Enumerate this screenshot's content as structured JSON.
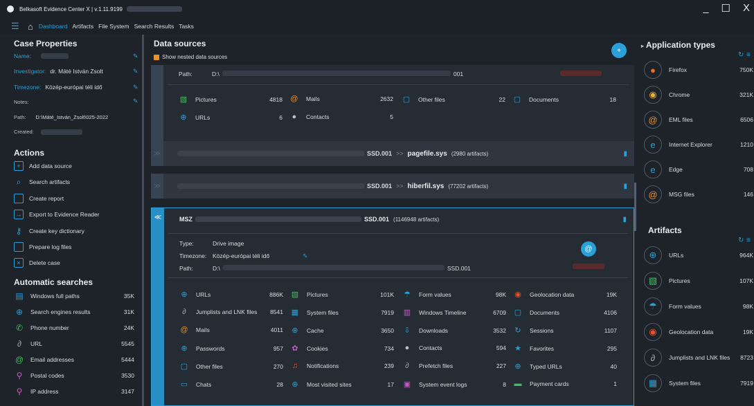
{
  "window": {
    "title": "Belkasoft Evidence Center X | v.1.11.9199",
    "minimize": "_",
    "maximize": "☐",
    "close": "X"
  },
  "menu": {
    "tabs": [
      "Dashboard",
      "Artifacts",
      "File System",
      "Search Results",
      "Tasks"
    ]
  },
  "case_properties": {
    "title": "Case Properties",
    "name_label": "Name:",
    "investigator_label": "Investigator:",
    "investigator": "dr. Máté István Zsolt",
    "timezone_label": "Timezone:",
    "timezone": "Közép-európai téli idő",
    "notes_label": "Notes:",
    "path_label": "Path:",
    "path": "D:\\Máté_István_Zsolt\\025-2022",
    "created_label": "Created:"
  },
  "actions": {
    "title": "Actions",
    "items": [
      "Add data source",
      "Search artifacts",
      "Create report",
      "Export to Evidence Reader",
      "Create key dictionary",
      "Prepare log files",
      "Delete case"
    ]
  },
  "auto_searches": {
    "title": "Automatic searches",
    "items": [
      {
        "label": "Windows full paths",
        "count": "35K"
      },
      {
        "label": "Search engines results",
        "count": "31K"
      },
      {
        "label": "Phone number",
        "count": "24K"
      },
      {
        "label": "URL",
        "count": "5545"
      },
      {
        "label": "Email addresses",
        "count": "5444"
      },
      {
        "label": "Postal codes",
        "count": "3530"
      },
      {
        "label": "IP address",
        "count": "3147"
      }
    ]
  },
  "data_sources": {
    "title": "Data sources",
    "nested_label": "Show nested data sources",
    "card1": {
      "path_label": "Path:",
      "path_prefix": "D:\\",
      "path_suffix": "001",
      "artifacts": [
        {
          "icon": "pictures-icon",
          "label": "Pictures",
          "count": "4818"
        },
        {
          "icon": "mails-icon",
          "label": "Mails",
          "count": "2632"
        },
        {
          "icon": "other-files-icon",
          "label": "Other files",
          "count": "22"
        },
        {
          "icon": "documents-icon",
          "label": "Documents",
          "count": "18"
        },
        {
          "icon": "urls-icon",
          "label": "URLs",
          "count": "6"
        },
        {
          "icon": "contacts-icon",
          "label": "Contacts",
          "count": "5"
        }
      ]
    },
    "collapsed": [
      {
        "ssd": "SSD.001",
        "arrow": ">>",
        "file": "pagefile.sys",
        "info": "(2980 artifacts)"
      },
      {
        "ssd": "SSD.001",
        "arrow": ">>",
        "file": "hiberfil.sys",
        "info": "(77202 artifacts)"
      }
    ],
    "card2": {
      "name_prefix": "MSZ",
      "ssd": "SSD.001",
      "info": "(1146948 artifacts)",
      "type_label": "Type:",
      "type": "Drive image",
      "timezone_label": "Timezone:",
      "timezone": "Közép-európai téli idő",
      "path_label": "Path:",
      "path_prefix": "D:\\",
      "path_suffix": "SSD.001",
      "artifacts": [
        {
          "label": "URLs",
          "count": "886K"
        },
        {
          "label": "Pictures",
          "count": "101K"
        },
        {
          "label": "Form values",
          "count": "98K"
        },
        {
          "label": "Geolocation data",
          "count": "19K"
        },
        {
          "label": "Jumplists and LNK files",
          "count": "8541"
        },
        {
          "label": "System files",
          "count": "7919"
        },
        {
          "label": "Windows Timeline",
          "count": "6709"
        },
        {
          "label": "Documents",
          "count": "4106"
        },
        {
          "label": "Mails",
          "count": "4011"
        },
        {
          "label": "Cache",
          "count": "3650"
        },
        {
          "label": "Downloads",
          "count": "3532"
        },
        {
          "label": "Sessions",
          "count": "1107"
        },
        {
          "label": "Passwords",
          "count": "957"
        },
        {
          "label": "Cookies",
          "count": "734"
        },
        {
          "label": "Contacts",
          "count": "594"
        },
        {
          "label": "Favorites",
          "count": "295"
        },
        {
          "label": "Other files",
          "count": "270"
        },
        {
          "label": "Notifications",
          "count": "239"
        },
        {
          "label": "Prefetch files",
          "count": "227"
        },
        {
          "label": "Typed URLs",
          "count": "40"
        },
        {
          "label": "Chats",
          "count": "28"
        },
        {
          "label": "Most visited sites",
          "count": "17"
        },
        {
          "label": "System event logs",
          "count": "8"
        },
        {
          "label": "Payment cards",
          "count": "1"
        }
      ]
    }
  },
  "app_types": {
    "title": "Application types",
    "items": [
      {
        "label": "Firefox",
        "count": "750K"
      },
      {
        "label": "Chrome",
        "count": "321K"
      },
      {
        "label": "EML files",
        "count": "6506"
      },
      {
        "label": "Internet Explorer",
        "count": "1210"
      },
      {
        "label": "Edge",
        "count": "708"
      },
      {
        "label": "MSG files",
        "count": "146"
      }
    ]
  },
  "artifacts_panel": {
    "title": "Artifacts",
    "items": [
      {
        "label": "URLs",
        "count": "964K"
      },
      {
        "label": "Pictures",
        "count": "107K"
      },
      {
        "label": "Form values",
        "count": "98K"
      },
      {
        "label": "Geolocation data",
        "count": "19K"
      },
      {
        "label": "Jumplists and LNK files",
        "count": "8723"
      },
      {
        "label": "System files",
        "count": "7919"
      }
    ]
  }
}
